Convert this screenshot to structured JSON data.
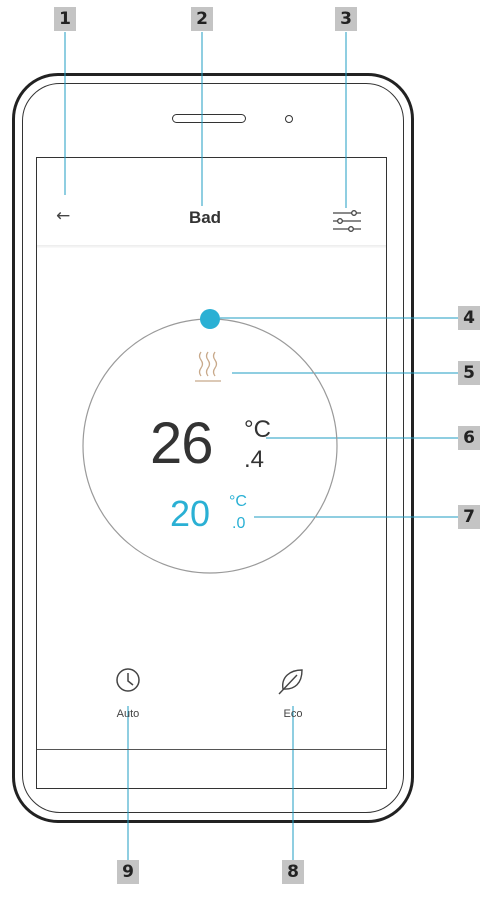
{
  "callouts": [
    "1",
    "2",
    "3",
    "4",
    "5",
    "6",
    "7",
    "8",
    "9"
  ],
  "screen": {
    "back_glyph": "←",
    "title": "Bad",
    "current_temp": {
      "whole": "26",
      "unit": "°C",
      "decimal": ".4"
    },
    "set_temp": {
      "whole": "20",
      "unit": "°C",
      "decimal": ".0"
    },
    "modes": [
      {
        "label": "Auto",
        "icon": "clock-icon"
      },
      {
        "label": "Eco",
        "icon": "leaf-icon"
      }
    ]
  },
  "colors": {
    "accent": "#2ab0d4",
    "badge": "#c4c4c4",
    "text": "#333333",
    "heat_icon": "#c8a98a"
  }
}
